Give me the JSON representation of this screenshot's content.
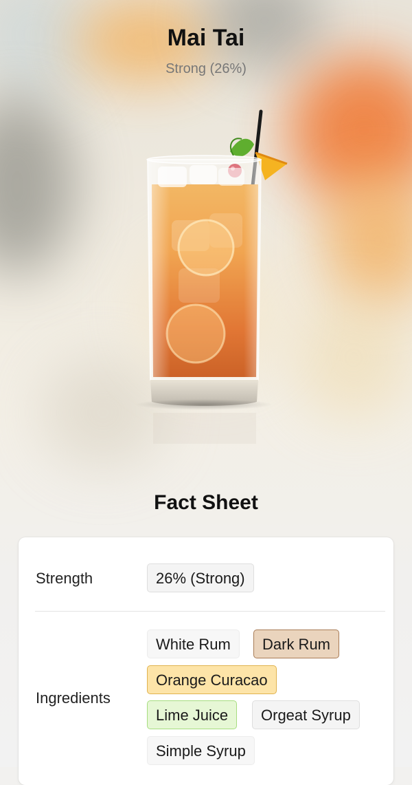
{
  "drink": {
    "name": "Mai Tai",
    "strength_label": "Strong (26%)"
  },
  "fact_sheet": {
    "title": "Fact Sheet",
    "strength": {
      "label": "Strength",
      "value": "26% (Strong)"
    },
    "ingredients": {
      "label": "Ingredients",
      "items": [
        {
          "name": "White Rum",
          "color": "#f7f7f7"
        },
        {
          "name": "Dark Rum",
          "color": "#ead4bd"
        },
        {
          "name": "Orange Curacao",
          "color": "#fde4a8"
        },
        {
          "name": "Lime Juice",
          "color": "#e6f7d5"
        },
        {
          "name": "Orgeat Syrup",
          "color": "#f4f4f4"
        },
        {
          "name": "Simple Syrup",
          "color": "#f7f7f7"
        }
      ]
    }
  },
  "icons": {
    "drink_image": "cocktail-glass-image"
  }
}
